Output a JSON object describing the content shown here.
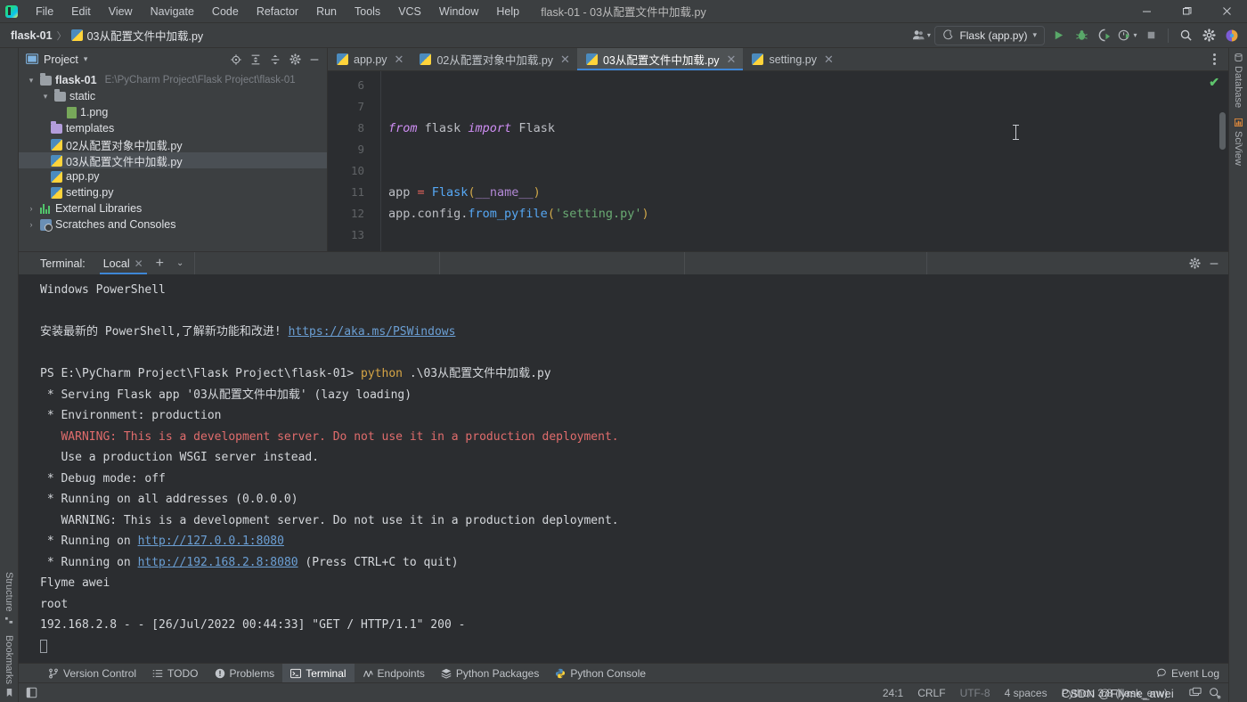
{
  "window": {
    "title": "flask-01 - 03从配置文件中加载.py",
    "minimize": "—",
    "maximize": "❐",
    "close": "✕"
  },
  "menubar": {
    "items": [
      "File",
      "Edit",
      "View",
      "Navigate",
      "Code",
      "Refactor",
      "Run",
      "Tools",
      "VCS",
      "Window",
      "Help"
    ]
  },
  "navbar": {
    "breadcrumb": {
      "root": "flask-01",
      "separator": "〉",
      "file": "03从配置文件中加载.py"
    },
    "run_config": "Flask (app.py)",
    "icons": [
      "profile-icon",
      "run-icon",
      "debug-icon",
      "coverage-icon",
      "profiler-icon",
      "stop-icon",
      "search-icon",
      "settings-icon",
      "updates-icon"
    ]
  },
  "project_panel": {
    "title": "Project",
    "toolbar_icons": [
      "locate-icon",
      "expand-all-icon",
      "collapse-all-icon",
      "settings-icon",
      "hide-icon"
    ],
    "tree": [
      {
        "label": "flask-01",
        "path": "E:\\PyCharm Project\\Flask Project\\flask-01",
        "icon": "folder-icon",
        "depth": 0,
        "twisty": "▾",
        "bold": true,
        "selected": false
      },
      {
        "label": "static",
        "path": "",
        "icon": "folder-icon",
        "depth": 1,
        "twisty": "▾",
        "bold": false,
        "selected": false
      },
      {
        "label": "1.png",
        "path": "",
        "icon": "image-file-icon",
        "depth": 2,
        "twisty": "",
        "bold": false,
        "selected": false
      },
      {
        "label": "templates",
        "path": "",
        "icon": "folder-purple-icon",
        "depth": 1,
        "twisty": "",
        "bold": false,
        "selected": false
      },
      {
        "label": "02从配置对象中加载.py",
        "path": "",
        "icon": "python-file-icon",
        "depth": 1,
        "twisty": "",
        "bold": false,
        "selected": false
      },
      {
        "label": "03从配置文件中加载.py",
        "path": "",
        "icon": "python-file-icon",
        "depth": 1,
        "twisty": "",
        "bold": false,
        "selected": true
      },
      {
        "label": "app.py",
        "path": "",
        "icon": "python-file-icon",
        "depth": 1,
        "twisty": "",
        "bold": false,
        "selected": false
      },
      {
        "label": "setting.py",
        "path": "",
        "icon": "python-file-icon",
        "depth": 1,
        "twisty": "",
        "bold": false,
        "selected": false
      },
      {
        "label": "External Libraries",
        "path": "",
        "icon": "library-icon",
        "depth": 0,
        "twisty": "›",
        "bold": false,
        "selected": false
      },
      {
        "label": "Scratches and Consoles",
        "path": "",
        "icon": "scratches-icon",
        "depth": 0,
        "twisty": "›",
        "bold": false,
        "selected": false
      }
    ]
  },
  "editor": {
    "tabs": [
      {
        "label": "app.py",
        "active": false
      },
      {
        "label": "02从配置对象中加载.py",
        "active": false
      },
      {
        "label": "03从配置文件中加载.py",
        "active": true
      },
      {
        "label": "setting.py",
        "active": false
      }
    ],
    "tab_close": "✕",
    "line_numbers": [
      "6",
      "7",
      "8",
      "9",
      "10",
      "11",
      "12",
      "13"
    ],
    "lines": [
      {
        "n": "6",
        "tokens": []
      },
      {
        "n": "7",
        "tokens": []
      },
      {
        "n": "8",
        "tokens": [
          {
            "t": "from",
            "c": "k-kw"
          },
          {
            "t": " flask ",
            "c": "k-plain"
          },
          {
            "t": "import",
            "c": "k-kw"
          },
          {
            "t": " Flask",
            "c": "k-plain"
          }
        ]
      },
      {
        "n": "9",
        "tokens": []
      },
      {
        "n": "10",
        "tokens": []
      },
      {
        "n": "11",
        "tokens": [
          {
            "t": "app ",
            "c": "k-plain"
          },
          {
            "t": "=",
            "c": "k-op"
          },
          {
            "t": " ",
            "c": "k-plain"
          },
          {
            "t": "Flask",
            "c": "k-cls"
          },
          {
            "t": "(",
            "c": "k-paren"
          },
          {
            "t": "__name__",
            "c": "k-name"
          },
          {
            "t": ")",
            "c": "k-paren"
          }
        ]
      },
      {
        "n": "12",
        "tokens": [
          {
            "t": "app.config.",
            "c": "k-plain"
          },
          {
            "t": "from_pyfile",
            "c": "k-fn"
          },
          {
            "t": "(",
            "c": "k-paren"
          },
          {
            "t": "'setting.py'",
            "c": "k-str"
          },
          {
            "t": ")",
            "c": "k-paren"
          }
        ]
      },
      {
        "n": "13",
        "tokens": []
      }
    ],
    "inspection_status": "✔"
  },
  "terminal": {
    "label": "Terminal:",
    "tab": "Local",
    "tab_close": "✕",
    "add": "+",
    "chevron": "⌄",
    "actions": [
      "settings-icon",
      "hide-icon"
    ],
    "lines": [
      {
        "segments": [
          {
            "t": "Windows PowerShell",
            "c": "t-white"
          }
        ]
      },
      {
        "segments": []
      },
      {
        "segments": [
          {
            "t": "安装最新的 PowerShell,了解新功能和改进! ",
            "c": "t-white"
          },
          {
            "t": "https://aka.ms/PSWindows",
            "c": "t-link"
          }
        ]
      },
      {
        "segments": []
      },
      {
        "segments": [
          {
            "t": "PS E:\\PyCharm Project\\Flask Project\\flask-01> ",
            "c": "t-white"
          },
          {
            "t": "python",
            "c": "t-yellow"
          },
          {
            "t": " .\\03从配置文件中加载.py",
            "c": "t-white"
          }
        ]
      },
      {
        "segments": [
          {
            "t": " * Serving Flask app '03从配置文件中加载' (lazy loading)",
            "c": "t-white"
          }
        ]
      },
      {
        "segments": [
          {
            "t": " * Environment: production",
            "c": "t-white"
          }
        ]
      },
      {
        "segments": [
          {
            "t": "   WARNING: This is a development server. Do not use it in a production deployment.",
            "c": "t-red"
          }
        ]
      },
      {
        "segments": [
          {
            "t": "   Use a production WSGI server instead.",
            "c": "t-white"
          }
        ]
      },
      {
        "segments": [
          {
            "t": " * Debug mode: off",
            "c": "t-white"
          }
        ]
      },
      {
        "segments": [
          {
            "t": " * Running on all addresses (0.0.0.0)",
            "c": "t-white"
          }
        ]
      },
      {
        "segments": [
          {
            "t": "   WARNING: This is a development server. Do not use it in a production deployment.",
            "c": "t-white"
          }
        ]
      },
      {
        "segments": [
          {
            "t": " * Running on ",
            "c": "t-white"
          },
          {
            "t": "http://127.0.0.1:8080",
            "c": "t-link"
          }
        ]
      },
      {
        "segments": [
          {
            "t": " * Running on ",
            "c": "t-white"
          },
          {
            "t": "http://192.168.2.8:8080",
            "c": "t-link"
          },
          {
            "t": " (Press CTRL+C to quit)",
            "c": "t-white"
          }
        ]
      },
      {
        "segments": [
          {
            "t": "Flyme awei",
            "c": "t-white"
          }
        ]
      },
      {
        "segments": [
          {
            "t": "root",
            "c": "t-white"
          }
        ]
      },
      {
        "segments": [
          {
            "t": "192.168.2.8 - - [26/Jul/2022 00:44:33] \"GET / HTTP/1.1\" 200 -",
            "c": "t-white"
          }
        ]
      }
    ]
  },
  "tool_strip": {
    "items": [
      {
        "label": "Version Control",
        "icon": "branch-icon",
        "active": false
      },
      {
        "label": "TODO",
        "icon": "list-icon",
        "active": false
      },
      {
        "label": "Problems",
        "icon": "warning-icon",
        "active": false
      },
      {
        "label": "Terminal",
        "icon": "terminal-icon",
        "active": true
      },
      {
        "label": "Endpoints",
        "icon": "endpoints-icon",
        "active": false
      },
      {
        "label": "Python Packages",
        "icon": "packages-icon",
        "active": false
      },
      {
        "label": "Python Console",
        "icon": "python-icon",
        "active": false
      }
    ],
    "event_log": "Event Log"
  },
  "status_bar": {
    "caret": "24:1",
    "line_separator": "CRLF",
    "encoding": "UTF-8",
    "indent": "4 spaces",
    "interpreter": "Python 3.8 (flask_env)",
    "icons": [
      "notifications-icon",
      "inspections-icon"
    ]
  },
  "left_rail": {
    "items": [
      "Structure",
      "Bookmarks"
    ]
  },
  "right_rail": {
    "items": [
      "Database",
      "SciView"
    ]
  },
  "watermark": "CSDN @Flyme_awei",
  "colors": {
    "accent": "#3e86d6",
    "panel": "#3c3f41",
    "editor_bg": "#2b2d30",
    "selection": "#4a4f54",
    "error": "#e06c6c",
    "link": "#6b9fd4",
    "ok": "#5ec46c"
  }
}
